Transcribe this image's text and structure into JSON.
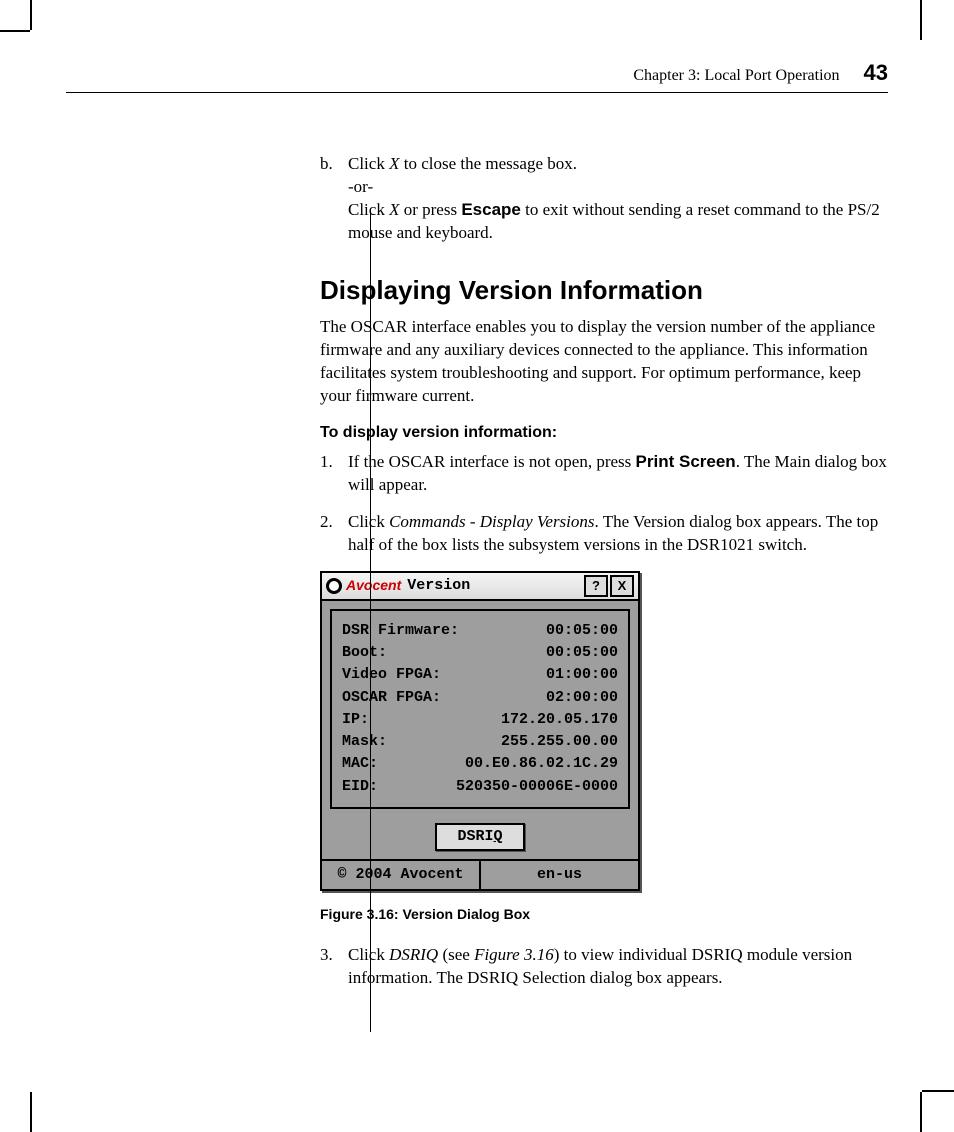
{
  "header": {
    "chapter": "Chapter 3: Local Port Operation",
    "page_number": "43"
  },
  "step_b": {
    "letter": "b.",
    "line1_pre": "Click ",
    "line1_x": "X",
    "line1_post": " to close the message box.",
    "or": "-or-",
    "line2_pre": "Click ",
    "line2_x": "X",
    "line2_mid": " or press ",
    "line2_escape": "Escape",
    "line2_post": " to exit without sending a reset command to the PS/2 mouse and keyboard."
  },
  "heading": "Displaying Version Information",
  "intro": "The OSCAR interface enables you to display the version number of the appliance firmware and any auxiliary devices connected to the appliance. This information facilitates system troubleshooting and support. For optimum performance, keep your firmware current.",
  "subhead": "To display version information:",
  "step1": {
    "num": "1.",
    "pre": "If the OSCAR interface is not open, press ",
    "ps": "Print Screen",
    "post": ". The Main dialog box will appear."
  },
  "step2": {
    "num": "2.",
    "pre": "Click ",
    "cmd": "Commands - Display Versions",
    "post": ". The Version dialog box appears. The top half of the box lists the subsystem versions in the DSR1021 switch."
  },
  "dialog": {
    "brand": "Avocent",
    "title": "Version",
    "help": "?",
    "close": "X",
    "rows": [
      {
        "label": "DSR Firmware:",
        "value": "00:05:00"
      },
      {
        "label": "Boot:",
        "value": "00:05:00"
      },
      {
        "label": "Video FPGA:",
        "value": "01:00:00"
      },
      {
        "label": "OSCAR FPGA:",
        "value": "02:00:00"
      },
      {
        "label": "IP:",
        "value": "172.20.05.170"
      },
      {
        "label": "Mask:",
        "value": "255.255.00.00"
      },
      {
        "label": "MAC:",
        "value": "00.E0.86.02.1C.29"
      },
      {
        "label": "EID:",
        "value": "520350-00006E-0000"
      }
    ],
    "button_pre": "DSRI",
    "button_ul": "Q",
    "footer_left": "© 2004 Avocent",
    "footer_right": "en-us"
  },
  "caption": "Figure 3.16: Version Dialog Box",
  "step3": {
    "num": "3.",
    "pre": "Click ",
    "dsriq": "DSRIQ",
    "mid": " (see ",
    "figref": "Figure 3.16",
    "post": ") to view individual DSRIQ module version information. The DSRIQ Selection dialog box appears."
  }
}
